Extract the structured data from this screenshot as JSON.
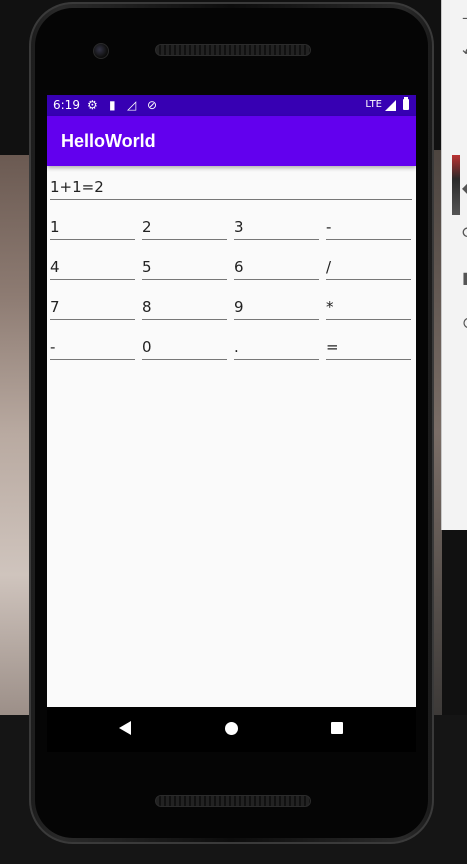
{
  "status_bar": {
    "time": "6:19",
    "network": "LTE",
    "icons": [
      "settings-icon",
      "sd-card-icon",
      "no-signal-icon",
      "sync-icon",
      "signal-icon",
      "battery-icon"
    ]
  },
  "app": {
    "title": "HelloWorld"
  },
  "display": {
    "value": "1+1=2"
  },
  "keypad": {
    "rows": [
      [
        "1",
        "2",
        "3",
        "-"
      ],
      [
        "4",
        "5",
        "6",
        "/"
      ],
      [
        "7",
        "8",
        "9",
        "*"
      ],
      [
        "-",
        "0",
        ".",
        "="
      ]
    ]
  },
  "colors": {
    "status_bar": "#3700b3",
    "app_bar": "#6200ee",
    "screen_bg": "#fafafa"
  },
  "nav": {
    "icons": [
      "back-icon",
      "home-icon",
      "recents-icon"
    ]
  }
}
